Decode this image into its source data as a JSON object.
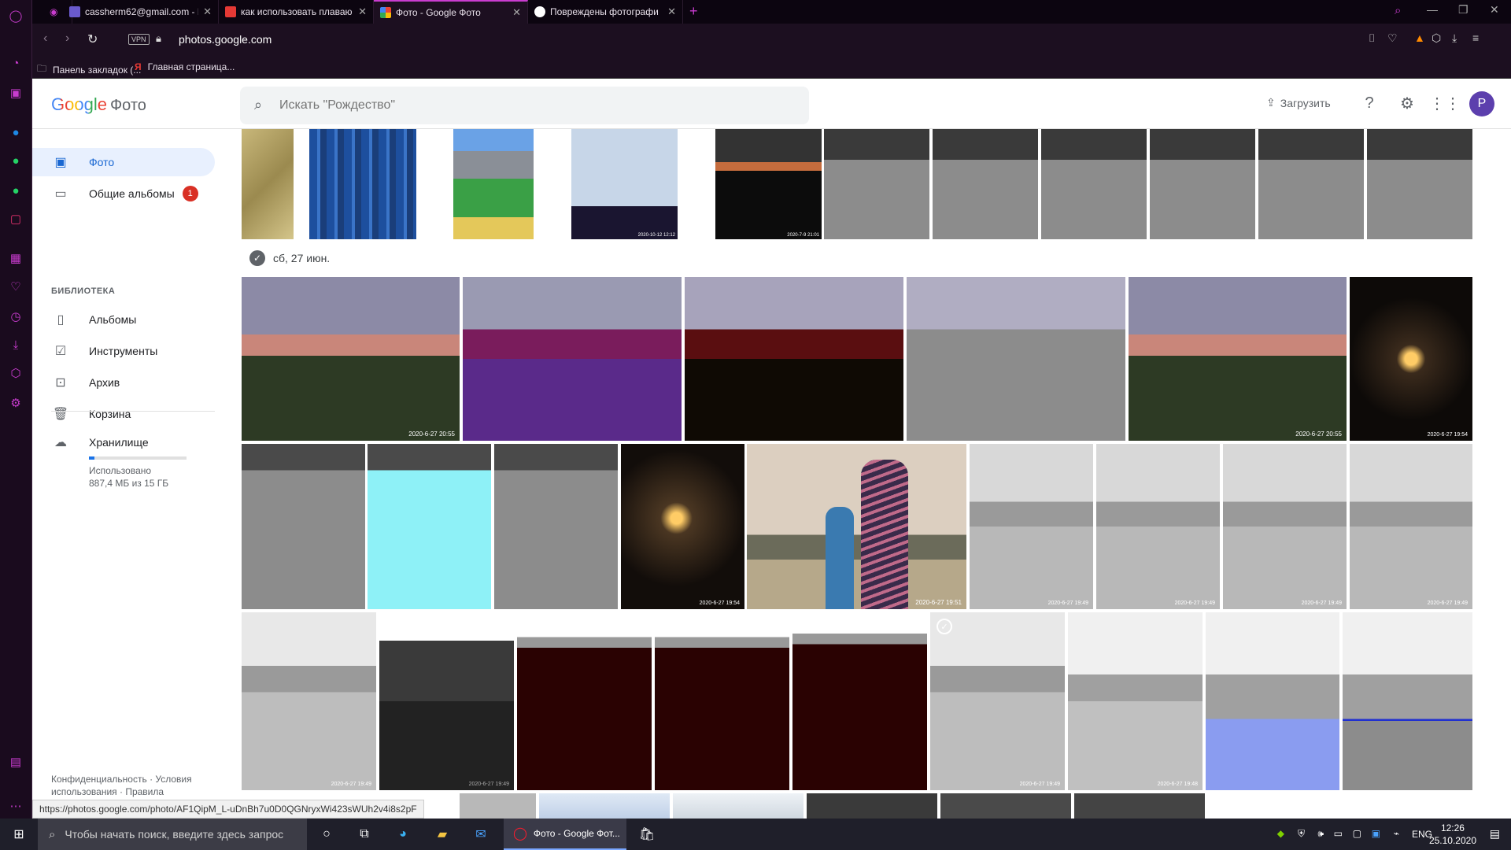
{
  "browser": {
    "tabs": [
      {
        "title": "cassherm62@gmail.com - Г",
        "active": false,
        "favicon_color": "#6a5acd"
      },
      {
        "title": "как использовать плаваю",
        "active": false,
        "favicon_color": "#e53935"
      },
      {
        "title": "Фото - Google Фото",
        "active": true,
        "favicon_color": "#fbbc05"
      },
      {
        "title": "Повреждены фотографи",
        "active": false,
        "favicon_color": "#ffffff"
      }
    ],
    "new_tab_icon": "plus-icon",
    "vpn_label": "VPN",
    "url_host": "photos.google.com",
    "bookmarks": [
      {
        "label": "Панель закладок (...",
        "icon": "folder-icon"
      },
      {
        "label": "Главная страница...",
        "icon": "yandex-icon"
      }
    ],
    "status_url": "https://photos.google.com/photo/AF1QipM_L-uDnBh7u0D0QGNryxWi423sWUh2v4i8s2pF"
  },
  "header": {
    "logo_google": "Google",
    "logo_product": "Фото",
    "search_placeholder": "Искать \"Рождество\"",
    "upload_label": "Загрузить",
    "avatar_letter": "P"
  },
  "sidebar": {
    "items": [
      {
        "label": "Фото",
        "icon": "photo-icon",
        "active": true
      },
      {
        "label": "Общие альбомы",
        "icon": "chat-icon",
        "badge": "1"
      }
    ],
    "library_heading": "БИБЛИОТЕКА",
    "library_items": [
      {
        "label": "Альбомы",
        "icon": "album-icon"
      },
      {
        "label": "Инструменты",
        "icon": "tools-icon"
      },
      {
        "label": "Архив",
        "icon": "archive-icon"
      },
      {
        "label": "Корзина",
        "icon": "trash-icon"
      }
    ],
    "storage": {
      "label": "Хранилище",
      "used_label": "Использовано",
      "used_value": "887,4 МБ из 15 ГБ",
      "fill_fraction": 0.06
    },
    "footer": [
      "Конфиденциальность",
      "Условия использования",
      "Правила"
    ]
  },
  "content": {
    "date_heading": "сб, 27 июн.",
    "timestamps": [
      "2020-7-9 21:01",
      "2020-10-12 12:12",
      "2020-6-27 20:55",
      "2020-6-27 19:54",
      "2020-6-27 19:51",
      "2020-6-27 19:49",
      "2020-6-27 19:48"
    ]
  },
  "taskbar": {
    "search_placeholder": "Чтобы начать поиск, введите здесь запрос",
    "active_app": "Фото - Google Фот...",
    "lang": "ENG",
    "time": "12:26",
    "date": "25.10.2020"
  }
}
